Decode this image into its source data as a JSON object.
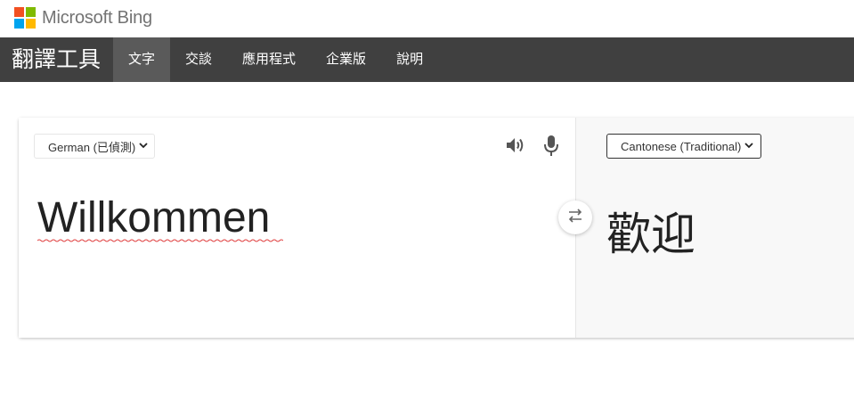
{
  "header": {
    "brand": "Microsoft Bing",
    "logo_colors": [
      "#f25022",
      "#7fba00",
      "#00a4ef",
      "#ffb900"
    ]
  },
  "nav": {
    "title": "翻譯工具",
    "tabs": [
      {
        "label": "文字",
        "active": true
      },
      {
        "label": "交談",
        "active": false
      },
      {
        "label": "應用程式",
        "active": false
      },
      {
        "label": "企業版",
        "active": false
      },
      {
        "label": "說明",
        "active": false
      }
    ]
  },
  "translator": {
    "source": {
      "language": "German (已偵測)",
      "text": "Willkommen"
    },
    "target": {
      "language": "Cantonese (Traditional)",
      "text": "歡迎"
    },
    "icons": {
      "speaker": "speaker-icon",
      "mic": "microphone-icon",
      "swap": "swap-icon",
      "dropdown": "chevron-down-icon"
    }
  }
}
